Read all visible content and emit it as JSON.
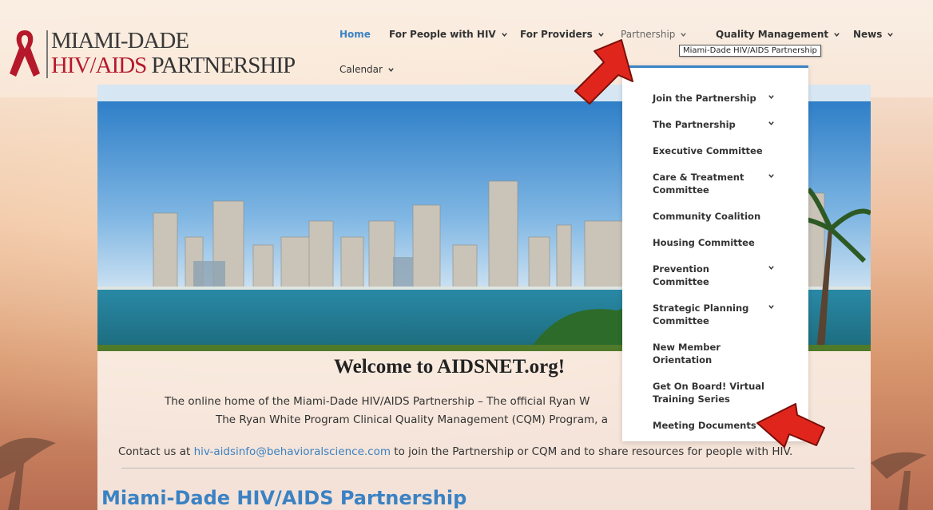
{
  "logo": {
    "line1": "MIAMI-DADE",
    "line2_red": "HIV/AIDS",
    "line2_dark": " PARTNERSHIP",
    "ribbon_color": "#b5182a"
  },
  "nav": {
    "home": "Home",
    "people": "For People with HIV",
    "providers": "For Providers",
    "partnership": "Partnership",
    "quality": "Quality Management",
    "news": "News",
    "calendar": "Calendar"
  },
  "tooltip": "Miami-Dade HIV/AIDS Partnership",
  "dropdown": {
    "items": [
      {
        "label": "Join the Partnership",
        "has_submenu": true
      },
      {
        "label": "The Partnership",
        "has_submenu": true
      },
      {
        "label": "Executive Committee",
        "has_submenu": false
      },
      {
        "label": "Care & Treatment Committee",
        "has_submenu": true
      },
      {
        "label": "Community Coalition",
        "has_submenu": false
      },
      {
        "label": "Housing Committee",
        "has_submenu": false
      },
      {
        "label": "Prevention Committee",
        "has_submenu": true
      },
      {
        "label": "Strategic Planning Committee",
        "has_submenu": true
      },
      {
        "label": "New Member Orientation",
        "has_submenu": false
      },
      {
        "label": "Get On Board! Virtual Training Series",
        "has_submenu": false
      },
      {
        "label": "Meeting Documents",
        "has_submenu": false
      }
    ]
  },
  "main": {
    "welcome": "Welcome to AIDSNET.org!",
    "line1": "The online home of the Miami-Dade HIV/AIDS Partnership – The official Ryan W",
    "line2": "The Ryan White Program Clinical Quality Management (CQM) Program, a",
    "line3_pre": "Contact us at ",
    "line3_link": "hiv-aidsinfo@behavioralscience.com",
    "line3_post": " to join the Partnership or CQM and to share resources for people with HIV.",
    "section_title": "Miami-Dade HIV/AIDS Partnership"
  },
  "colors": {
    "accent": "#3b82c4",
    "annotation_arrow": "#e0261c"
  }
}
